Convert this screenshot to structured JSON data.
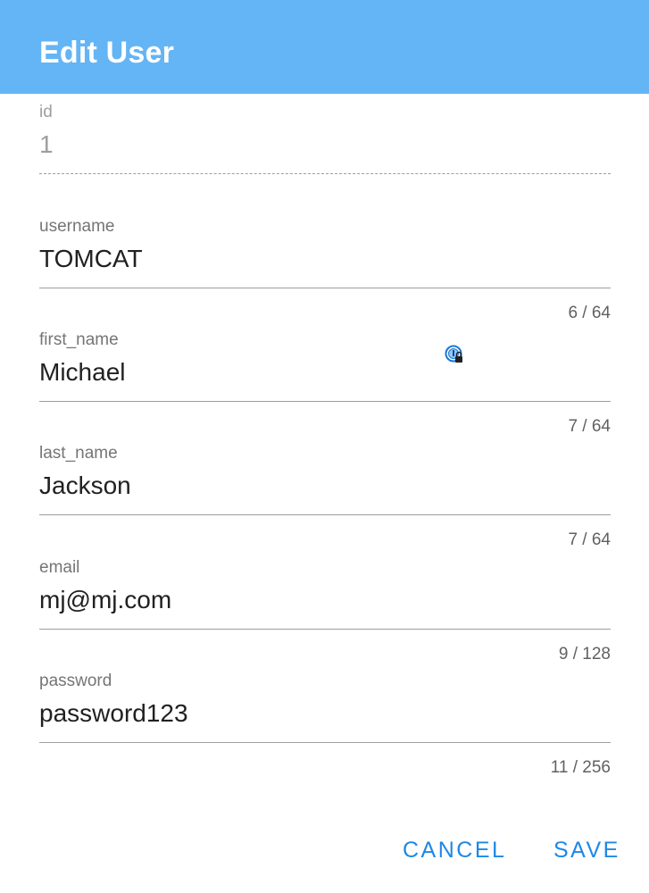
{
  "dialog": {
    "title": "Edit User"
  },
  "fields": {
    "id": {
      "label": "id",
      "value": "1"
    },
    "username": {
      "label": "username",
      "value": "TOMCAT",
      "counter": "6 / 64"
    },
    "first_name": {
      "label": "first_name",
      "value": "Michael",
      "counter": "7 / 64"
    },
    "last_name": {
      "label": "last_name",
      "value": "Jackson",
      "counter": "7 / 64"
    },
    "email": {
      "label": "email",
      "value": "mj@mj.com",
      "counter": "9 / 128"
    },
    "password": {
      "label": "password",
      "value": "password123",
      "counter": "11 / 256"
    }
  },
  "actions": {
    "cancel_label": "CANCEL",
    "save_label": "SAVE"
  },
  "icons": {
    "password_manager": "password-manager-icon"
  },
  "colors": {
    "header": "#64b5f6",
    "accent": "#1e88e5"
  }
}
